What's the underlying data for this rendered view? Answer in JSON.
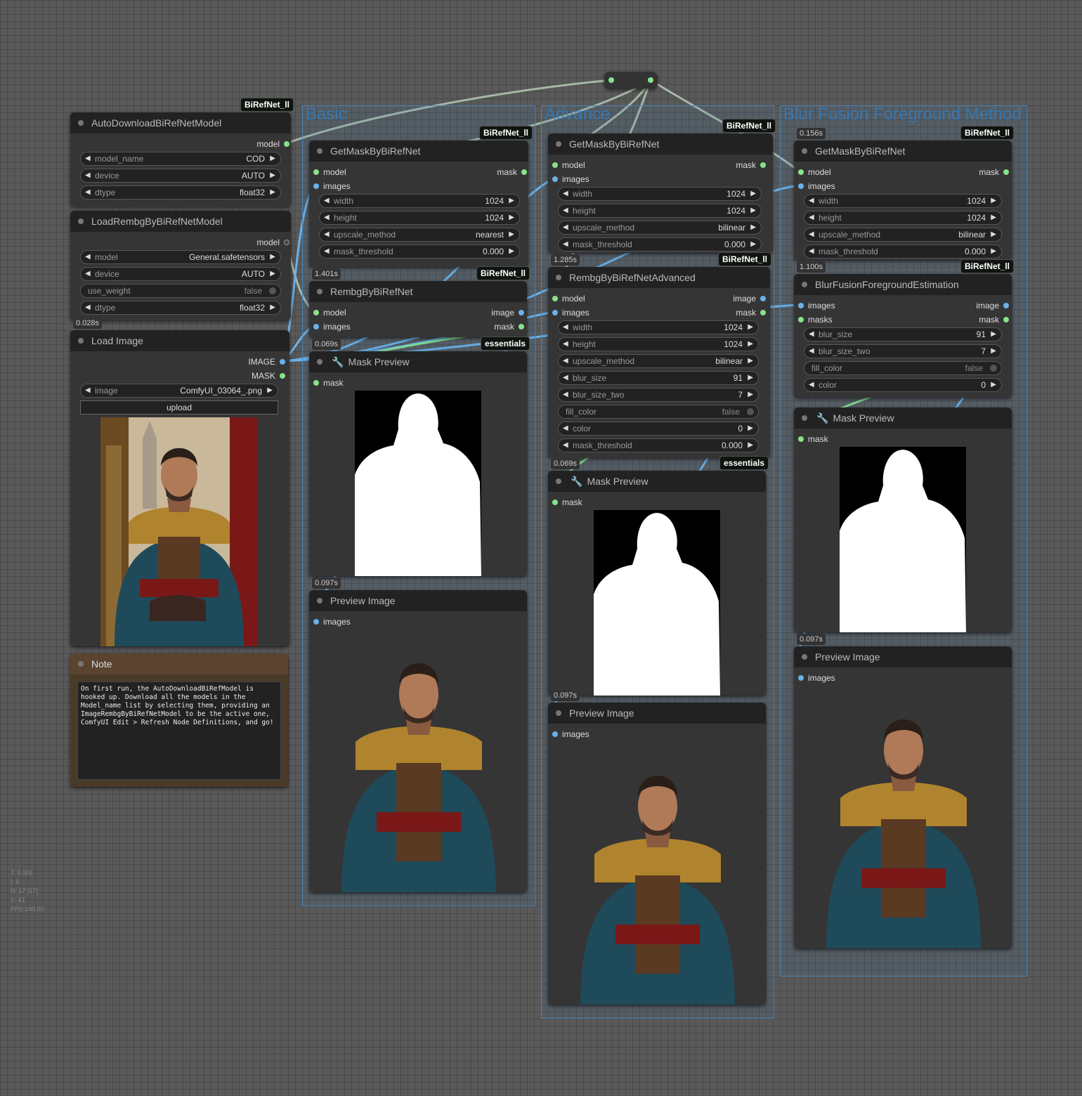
{
  "groups": {
    "basic": "Basic",
    "advance": "Advance",
    "blur": "Blur Fusion Foreground Method"
  },
  "tags": {
    "birefnet": "BiRefNet_ll",
    "essentials": "essentials"
  },
  "timings": {
    "t1": "0.028s",
    "t2": "1.401s",
    "t3": "0.069s",
    "t4": "0.097s",
    "t5": "1.285s",
    "t6": "0.069s",
    "t7": "0.097s",
    "t8": "0.156s",
    "t9": "1.100s",
    "t10": "0.097s"
  },
  "auto_download": {
    "title": "AutoDownloadBiRefNetModel",
    "out_model": "model",
    "model_name_label": "model_name",
    "model_name_value": "COD",
    "device_label": "device",
    "device_value": "AUTO",
    "dtype_label": "dtype",
    "dtype_value": "float32"
  },
  "load_rembg": {
    "title": "LoadRembgByBiRefNetModel",
    "out_model": "model",
    "model_label": "model",
    "model_value": "General.safetensors",
    "device_label": "device",
    "device_value": "AUTO",
    "use_weight_label": "use_weight",
    "use_weight_value": "false",
    "dtype_label": "dtype",
    "dtype_value": "float32"
  },
  "load_image": {
    "title": "Load Image",
    "out_image": "IMAGE",
    "out_mask": "MASK",
    "image_label": "image",
    "image_value": "ComfyUI_03064_.png",
    "upload": "upload"
  },
  "note": {
    "title": "Note",
    "text": "On first run, the AutoDownloadBiRefModel is hooked up. Download all the models in the Model_name list by selecting them, providing an ImageRembgByBiRefNetModel to be the active one, ComfyUI Edit > Refresh Node Definitions, and go!"
  },
  "getmask_basic": {
    "title": "GetMaskByBiRefNet",
    "in_model": "model",
    "in_images": "images",
    "out_mask": "mask",
    "width_label": "width",
    "width_value": "1024",
    "height_label": "height",
    "height_value": "1024",
    "upscale_label": "upscale_method",
    "upscale_value": "nearest",
    "threshold_label": "mask_threshold",
    "threshold_value": "0.000"
  },
  "rembg_basic": {
    "title": "RembgByBiRefNet",
    "in_model": "model",
    "in_images": "images",
    "out_image": "image",
    "out_mask": "mask"
  },
  "mask_preview_basic": {
    "title": "Mask Preview",
    "in_mask": "mask"
  },
  "preview_basic": {
    "title": "Preview Image",
    "in_images": "images"
  },
  "getmask_adv": {
    "title": "GetMaskByBiRefNet",
    "in_model": "model",
    "in_images": "images",
    "out_mask": "mask",
    "width_label": "width",
    "width_value": "1024",
    "height_label": "height",
    "height_value": "1024",
    "upscale_label": "upscale_method",
    "upscale_value": "bilinear",
    "threshold_label": "mask_threshold",
    "threshold_value": "0.000"
  },
  "rembg_adv": {
    "title": "RembgByBiRefNetAdvanced",
    "in_model": "model",
    "in_images": "images",
    "out_image": "image",
    "out_mask": "mask",
    "width_label": "width",
    "width_value": "1024",
    "height_label": "height",
    "height_value": "1024",
    "upscale_label": "upscale_method",
    "upscale_value": "bilinear",
    "blur_label": "blur_size",
    "blur_value": "91",
    "blur2_label": "blur_size_two",
    "blur2_value": "7",
    "fill_label": "fill_color",
    "fill_value": "false",
    "color_label": "color",
    "color_value": "0",
    "threshold_label": "mask_threshold",
    "threshold_value": "0.000"
  },
  "mask_preview_adv": {
    "title": "Mask Preview",
    "in_mask": "mask"
  },
  "preview_adv": {
    "title": "Preview Image",
    "in_images": "images"
  },
  "getmask_blur": {
    "title": "GetMaskByBiRefNet",
    "in_model": "model",
    "in_images": "images",
    "out_mask": "mask",
    "width_label": "width",
    "width_value": "1024",
    "height_label": "height",
    "height_value": "1024",
    "upscale_label": "upscale_method",
    "upscale_value": "bilinear",
    "threshold_label": "mask_threshold",
    "threshold_value": "0.000"
  },
  "blur_fusion": {
    "title": "BlurFusionForegroundEstimation",
    "in_images": "images",
    "in_masks": "masks",
    "out_image": "image",
    "out_mask": "mask",
    "blur_label": "blur_size",
    "blur_value": "91",
    "blur2_label": "blur_size_two",
    "blur2_value": "7",
    "fill_label": "fill_color",
    "fill_value": "false",
    "color_label": "color",
    "color_value": "0"
  },
  "mask_preview_blur": {
    "title": "Mask Preview",
    "in_mask": "mask"
  },
  "preview_blur": {
    "title": "Preview Image",
    "in_images": "images"
  },
  "hud": {
    "t": "T: 0.00s",
    "i": "I: 0",
    "n": "N: 17 [17]",
    "v": "V: 41",
    "fps": "FPS:100.00"
  },
  "colors": {
    "canvas": "#595959",
    "node": "#353535",
    "title": "#222222",
    "group": "#4a86b8",
    "link_green": "#8ae28a",
    "link_blue": "#6ab2ea"
  }
}
